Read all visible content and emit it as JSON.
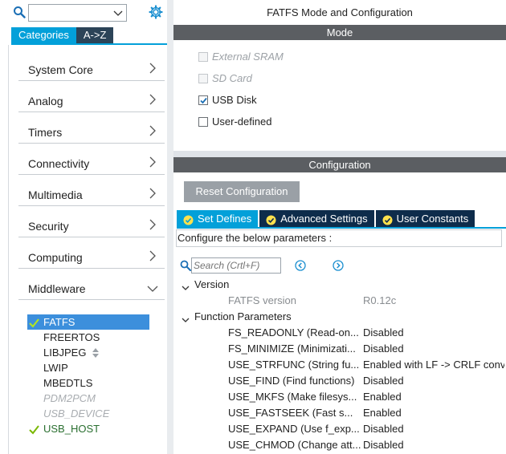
{
  "left": {
    "search": {
      "value": "",
      "placeholder": ""
    },
    "tabs": [
      {
        "label": "Categories",
        "active": true
      },
      {
        "label": "A->Z",
        "active": false
      }
    ],
    "categories": [
      {
        "label": "System Core",
        "expanded": false
      },
      {
        "label": "Analog",
        "expanded": false
      },
      {
        "label": "Timers",
        "expanded": false
      },
      {
        "label": "Connectivity",
        "expanded": false
      },
      {
        "label": "Multimedia",
        "expanded": false
      },
      {
        "label": "Security",
        "expanded": false
      },
      {
        "label": "Computing",
        "expanded": false
      },
      {
        "label": "Middleware",
        "expanded": true
      }
    ],
    "middleware": [
      {
        "label": "FATFS",
        "state": "selected",
        "checked": true
      },
      {
        "label": "FREERTOS",
        "state": "normal",
        "checked": false
      },
      {
        "label": "LIBJPEG",
        "state": "normal",
        "checked": false
      },
      {
        "label": "LWIP",
        "state": "normal",
        "checked": false
      },
      {
        "label": "MBEDTLS",
        "state": "normal",
        "checked": false
      },
      {
        "label": "PDM2PCM",
        "state": "disabled",
        "checked": false
      },
      {
        "label": "USB_DEVICE",
        "state": "disabled",
        "checked": false
      },
      {
        "label": "USB_HOST",
        "state": "enabled",
        "checked": true
      }
    ]
  },
  "right": {
    "title": "FATFS Mode and Configuration",
    "mode_header": "Mode",
    "mode_options": [
      {
        "label": "External SRAM",
        "checked": false,
        "disabled": true
      },
      {
        "label": "SD Card",
        "checked": false,
        "disabled": true
      },
      {
        "label": "USB Disk",
        "checked": true,
        "disabled": false
      },
      {
        "label": "User-defined",
        "checked": false,
        "disabled": false
      }
    ],
    "config_header": "Configuration",
    "reset_label": "Reset Configuration",
    "config_tabs": [
      {
        "label": "Set Defines",
        "active": true
      },
      {
        "label": "Advanced Settings",
        "active": false
      },
      {
        "label": "User Constants",
        "active": false
      }
    ],
    "hint": "Configure the below parameters :",
    "param_search": {
      "value": "",
      "placeholder": "Search (Crtl+F)"
    },
    "groups": [
      {
        "label": "Version",
        "params": [
          {
            "name": "FATFS version",
            "value": "R0.12c",
            "muted": true
          }
        ]
      },
      {
        "label": "Function Parameters",
        "params": [
          {
            "name": "FS_READONLY (Read-on...",
            "value": "Disabled",
            "muted": false
          },
          {
            "name": "FS_MINIMIZE (Minimizati...",
            "value": "Disabled",
            "muted": false
          },
          {
            "name": "USE_STRFUNC (String fu...",
            "value": "Enabled with LF -> CRLF conv",
            "muted": false
          },
          {
            "name": "USE_FIND (Find functions)",
            "value": "Disabled",
            "muted": false
          },
          {
            "name": "USE_MKFS (Make filesys...",
            "value": "Enabled",
            "muted": false
          },
          {
            "name": "USE_FASTSEEK (Fast s...",
            "value": "Enabled",
            "muted": false
          },
          {
            "name": "USE_EXPAND (Use f_exp...",
            "value": "Disabled",
            "muted": false
          },
          {
            "name": "USE_CHMOD (Change att...",
            "value": "Disabled",
            "muted": false
          }
        ]
      }
    ]
  },
  "colors": {
    "accent": "#03a0d9",
    "dark_tab": "#0e2c4b",
    "header_gray": "#5b5e62",
    "selection": "#3c8fdc",
    "check_green": "#7ab800"
  }
}
